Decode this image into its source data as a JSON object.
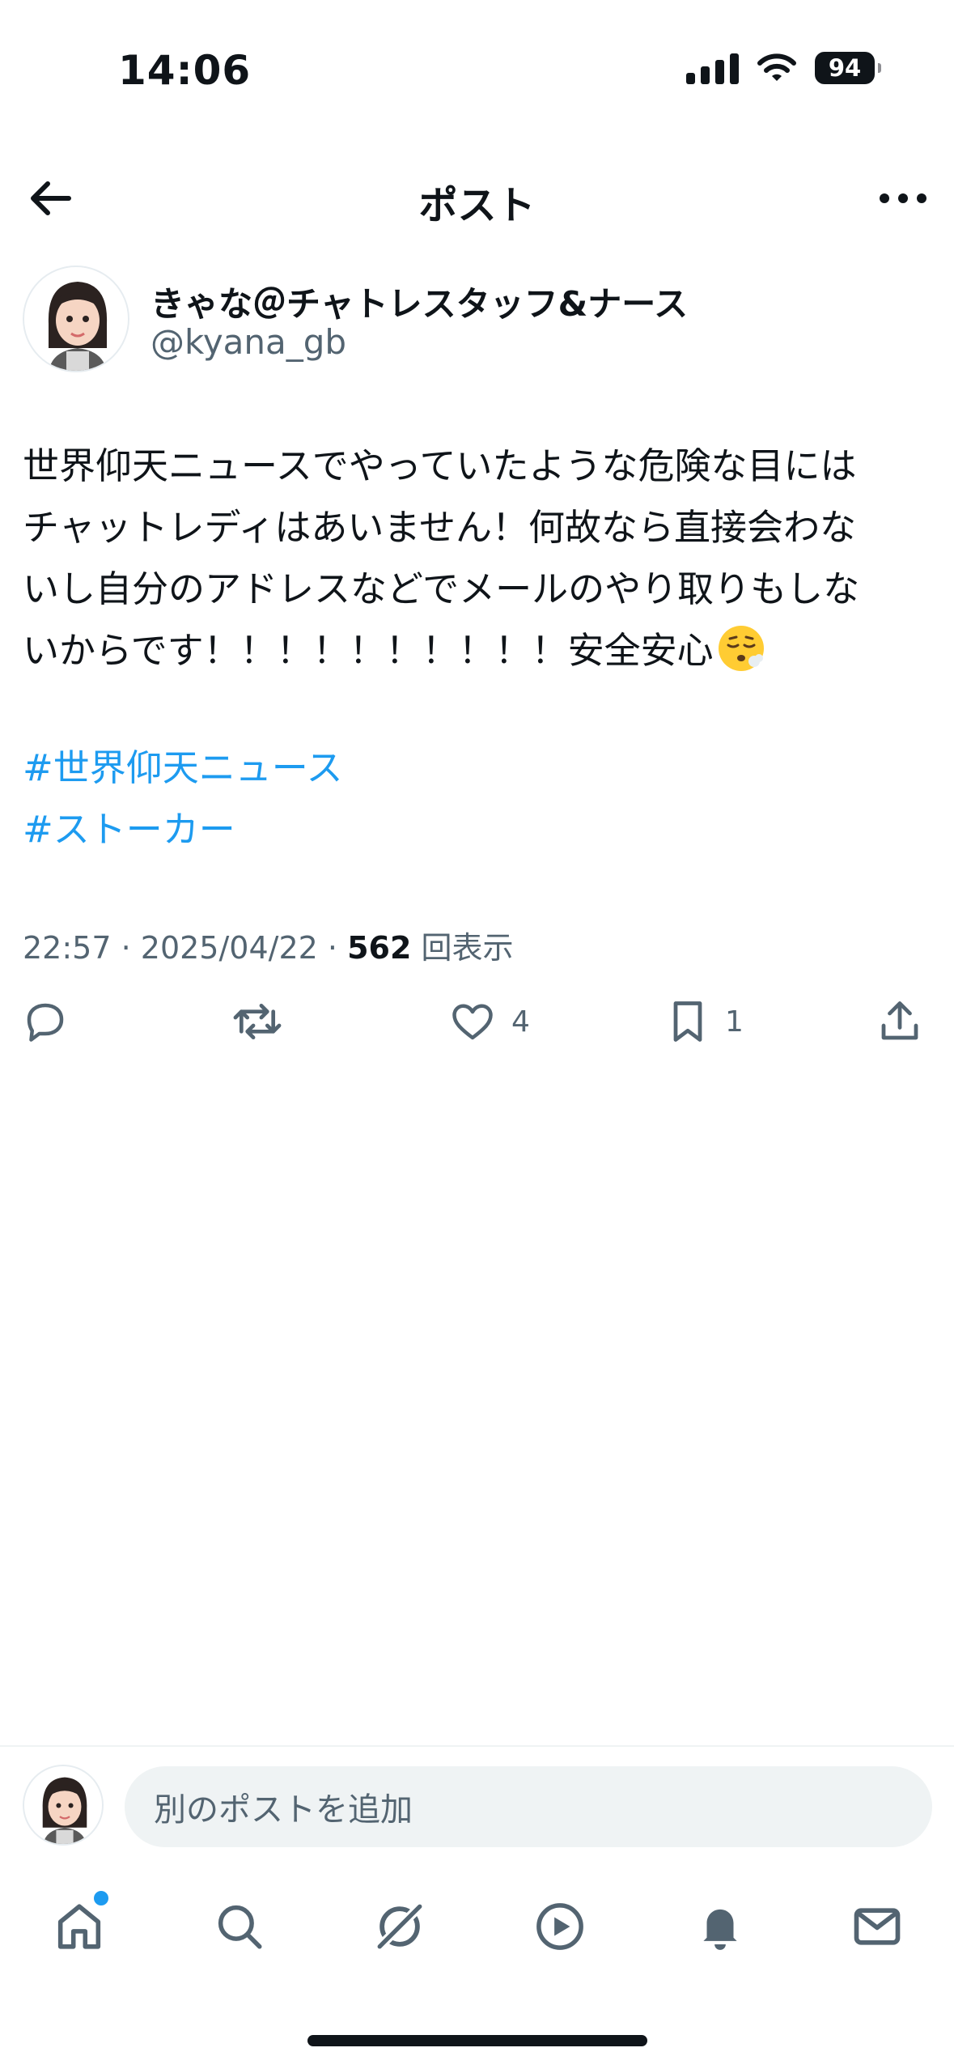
{
  "status_bar": {
    "time": "14:06",
    "battery": "94"
  },
  "header": {
    "title": "ポスト"
  },
  "author": {
    "display_name": "きゃな＠チャトレスタッフ&ナース",
    "handle": "@kyana_gb"
  },
  "post": {
    "lines": [
      "世界仰天ニュースでやっていたような危険な目には",
      "チャットレディはあいません！何故なら直接会わな",
      "いし自分のアドレスなどでメールのやり取りもしな",
      "いからです！！！！！！！！！！安全安心"
    ],
    "hashtags": [
      "#世界仰天ニュース",
      "#ストーカー"
    ],
    "time": "22:57",
    "date": "2025/04/22",
    "views_count": "562",
    "views_label": "回表示"
  },
  "actions": {
    "reply_count": "",
    "repost_count": "",
    "like_count": "4",
    "bookmark_count": "1"
  },
  "composer": {
    "placeholder": "別のポストを追加"
  },
  "icons": {
    "back": "arrow-left-icon",
    "more": "more-horizontal-icon",
    "reply": "reply-icon",
    "repost": "repost-icon",
    "like": "heart-icon",
    "bookmark": "bookmark-icon",
    "share": "share-icon",
    "tabs": [
      "home-icon",
      "search-icon",
      "grok-icon",
      "video-icon",
      "notifications-icon",
      "messages-icon"
    ]
  },
  "colors": {
    "link": "#1d9bf0",
    "secondary_text": "#536471",
    "primary_text": "#0f1419"
  }
}
